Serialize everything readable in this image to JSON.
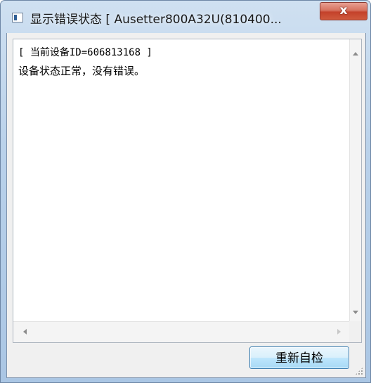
{
  "window": {
    "title": "显示错误状态 [ Ausetter800A32U(810400...",
    "close_label": "x"
  },
  "textarea": {
    "device_line": "[ 当前设备ID=606813168 ]",
    "status_line": "设备状态正常，没有错误。"
  },
  "scrollbars": {
    "up_icon": "arrow-up-icon",
    "down_icon": "arrow-down-icon",
    "left_icon": "arrow-left-icon",
    "right_icon": "arrow-right-icon"
  },
  "footer": {
    "recheck_label": "重新自检"
  },
  "colors": {
    "titlebar": "#b9d1ea",
    "close_button": "#c4422b",
    "client_bg": "#f0f0f0",
    "button_border": "#3c7fb1"
  }
}
